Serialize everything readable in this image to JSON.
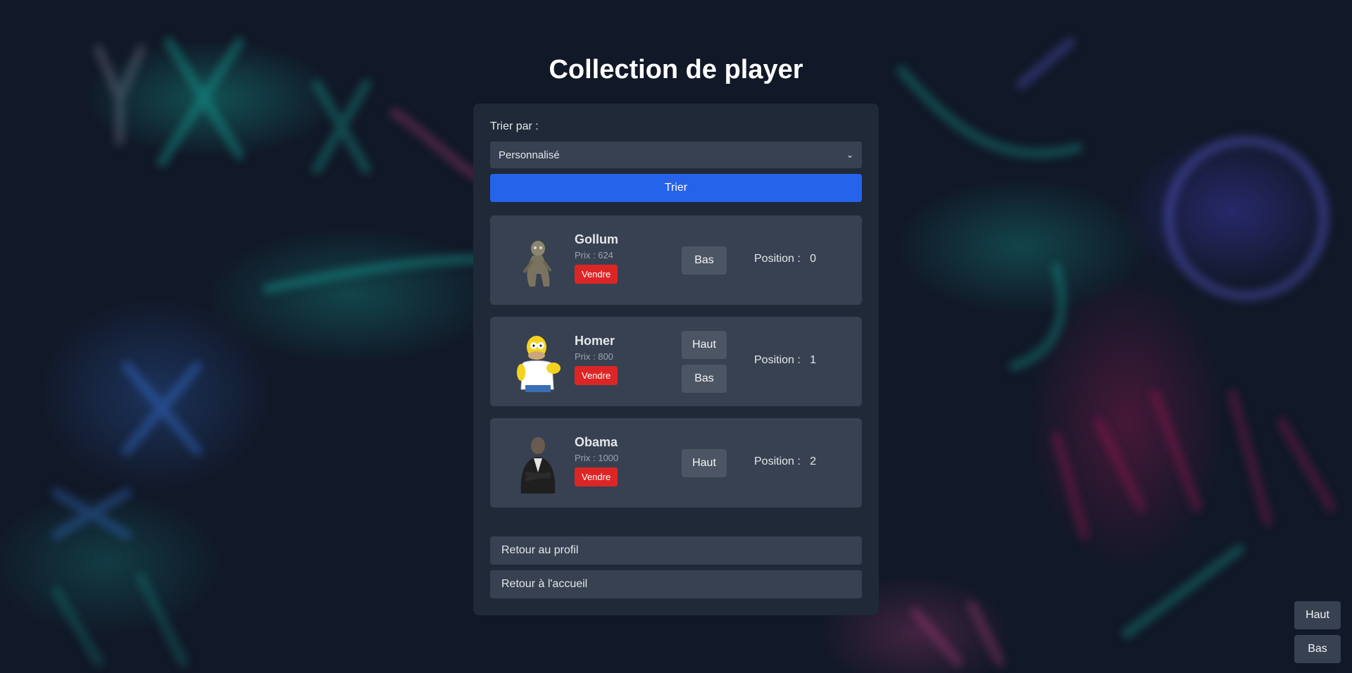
{
  "page": {
    "title": "Collection de player"
  },
  "sort": {
    "label": "Trier par :",
    "selected": "Personnalisé",
    "button": "Trier"
  },
  "players": [
    {
      "name": "Gollum",
      "price": "Prix : 624",
      "sell": "Vendre",
      "up": "",
      "down": "Bas",
      "position_label": "Position :",
      "position": "0",
      "image": "gollum-figure"
    },
    {
      "name": "Homer",
      "price": "Prix : 800",
      "sell": "Vendre",
      "up": "Haut",
      "down": "Bas",
      "position_label": "Position :",
      "position": "1",
      "image": "homer-figure"
    },
    {
      "name": "Obama",
      "price": "Prix : 1000",
      "sell": "Vendre",
      "up": "Haut",
      "down": "",
      "position_label": "Position :",
      "position": "2",
      "image": "obama-figure"
    }
  ],
  "footer": {
    "profile": "Retour au profil",
    "home": "Retour à l'accueil"
  },
  "scroll": {
    "top": "Haut",
    "bottom": "Bas"
  },
  "colors": {
    "primary": "#2563eb",
    "danger": "#dc2626",
    "panel": "#1f2937",
    "card": "#374151"
  }
}
